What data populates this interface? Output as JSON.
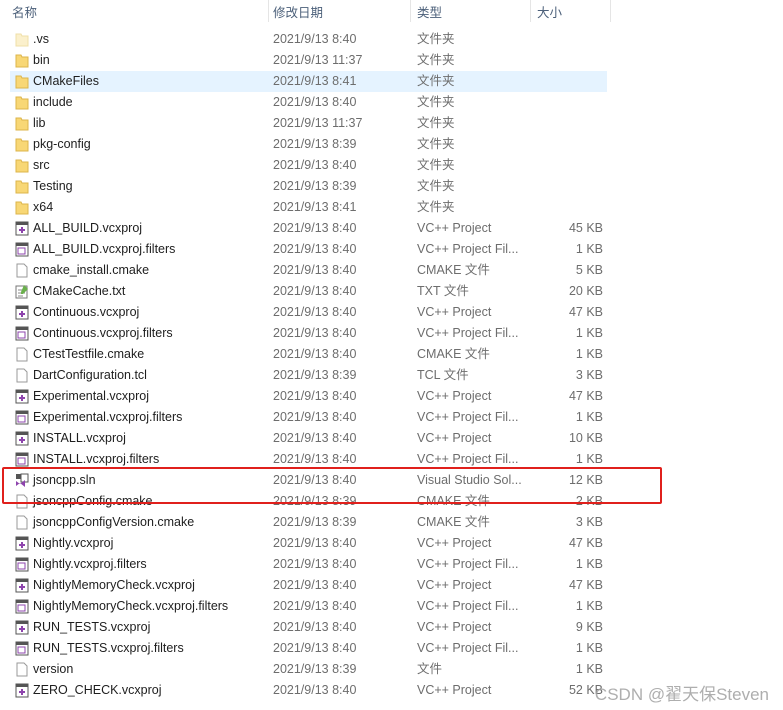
{
  "header": {
    "name": "名称",
    "date": "修改日期",
    "type": "类型",
    "size": "大小"
  },
  "files": [
    {
      "name": ".vs",
      "date": "2021/9/13 8:40",
      "type": "文件夹",
      "size": "",
      "icon": "folder-faded-icon"
    },
    {
      "name": "bin",
      "date": "2021/9/13 11:37",
      "type": "文件夹",
      "size": "",
      "icon": "folder-icon"
    },
    {
      "name": "CMakeFiles",
      "date": "2021/9/13 8:41",
      "type": "文件夹",
      "size": "",
      "icon": "folder-icon",
      "selected": true
    },
    {
      "name": "include",
      "date": "2021/9/13 8:40",
      "type": "文件夹",
      "size": "",
      "icon": "folder-icon"
    },
    {
      "name": "lib",
      "date": "2021/9/13 11:37",
      "type": "文件夹",
      "size": "",
      "icon": "folder-icon"
    },
    {
      "name": "pkg-config",
      "date": "2021/9/13 8:39",
      "type": "文件夹",
      "size": "",
      "icon": "folder-icon"
    },
    {
      "name": "src",
      "date": "2021/9/13 8:40",
      "type": "文件夹",
      "size": "",
      "icon": "folder-icon"
    },
    {
      "name": "Testing",
      "date": "2021/9/13 8:39",
      "type": "文件夹",
      "size": "",
      "icon": "folder-icon"
    },
    {
      "name": "x64",
      "date": "2021/9/13 8:41",
      "type": "文件夹",
      "size": "",
      "icon": "folder-icon"
    },
    {
      "name": "ALL_BUILD.vcxproj",
      "date": "2021/9/13 8:40",
      "type": "VC++ Project",
      "size": "45 KB",
      "icon": "vcxproj-icon"
    },
    {
      "name": "ALL_BUILD.vcxproj.filters",
      "date": "2021/9/13 8:40",
      "type": "VC++ Project Fil...",
      "size": "1 KB",
      "icon": "filters-icon"
    },
    {
      "name": "cmake_install.cmake",
      "date": "2021/9/13 8:40",
      "type": "CMAKE 文件",
      "size": "5 KB",
      "icon": "file-icon"
    },
    {
      "name": "CMakeCache.txt",
      "date": "2021/9/13 8:40",
      "type": "TXT 文件",
      "size": "20 KB",
      "icon": "text-file-icon"
    },
    {
      "name": "Continuous.vcxproj",
      "date": "2021/9/13 8:40",
      "type": "VC++ Project",
      "size": "47 KB",
      "icon": "vcxproj-icon"
    },
    {
      "name": "Continuous.vcxproj.filters",
      "date": "2021/9/13 8:40",
      "type": "VC++ Project Fil...",
      "size": "1 KB",
      "icon": "filters-icon"
    },
    {
      "name": "CTestTestfile.cmake",
      "date": "2021/9/13 8:40",
      "type": "CMAKE 文件",
      "size": "1 KB",
      "icon": "file-icon"
    },
    {
      "name": "DartConfiguration.tcl",
      "date": "2021/9/13 8:39",
      "type": "TCL 文件",
      "size": "3 KB",
      "icon": "file-icon"
    },
    {
      "name": "Experimental.vcxproj",
      "date": "2021/9/13 8:40",
      "type": "VC++ Project",
      "size": "47 KB",
      "icon": "vcxproj-icon"
    },
    {
      "name": "Experimental.vcxproj.filters",
      "date": "2021/9/13 8:40",
      "type": "VC++ Project Fil...",
      "size": "1 KB",
      "icon": "filters-icon"
    },
    {
      "name": "INSTALL.vcxproj",
      "date": "2021/9/13 8:40",
      "type": "VC++ Project",
      "size": "10 KB",
      "icon": "vcxproj-icon"
    },
    {
      "name": "INSTALL.vcxproj.filters",
      "date": "2021/9/13 8:40",
      "type": "VC++ Project Fil...",
      "size": "1 KB",
      "icon": "filters-icon"
    },
    {
      "name": "jsoncpp.sln",
      "date": "2021/9/13 8:40",
      "type": "Visual Studio Sol...",
      "size": "12 KB",
      "icon": "sln-icon"
    },
    {
      "name": "jsoncppConfig.cmake",
      "date": "2021/9/13 8:39",
      "type": "CMAKE 文件",
      "size": "2 KB",
      "icon": "file-icon"
    },
    {
      "name": "jsoncppConfigVersion.cmake",
      "date": "2021/9/13 8:39",
      "type": "CMAKE 文件",
      "size": "3 KB",
      "icon": "file-icon"
    },
    {
      "name": "Nightly.vcxproj",
      "date": "2021/9/13 8:40",
      "type": "VC++ Project",
      "size": "47 KB",
      "icon": "vcxproj-icon"
    },
    {
      "name": "Nightly.vcxproj.filters",
      "date": "2021/9/13 8:40",
      "type": "VC++ Project Fil...",
      "size": "1 KB",
      "icon": "filters-icon"
    },
    {
      "name": "NightlyMemoryCheck.vcxproj",
      "date": "2021/9/13 8:40",
      "type": "VC++ Project",
      "size": "47 KB",
      "icon": "vcxproj-icon"
    },
    {
      "name": "NightlyMemoryCheck.vcxproj.filters",
      "date": "2021/9/13 8:40",
      "type": "VC++ Project Fil...",
      "size": "1 KB",
      "icon": "filters-icon"
    },
    {
      "name": "RUN_TESTS.vcxproj",
      "date": "2021/9/13 8:40",
      "type": "VC++ Project",
      "size": "9 KB",
      "icon": "vcxproj-icon"
    },
    {
      "name": "RUN_TESTS.vcxproj.filters",
      "date": "2021/9/13 8:40",
      "type": "VC++ Project Fil...",
      "size": "1 KB",
      "icon": "filters-icon"
    },
    {
      "name": "version",
      "date": "2021/9/13 8:39",
      "type": "文件",
      "size": "1 KB",
      "icon": "file-icon"
    },
    {
      "name": "ZERO_CHECK.vcxproj",
      "date": "2021/9/13 8:40",
      "type": "VC++ Project",
      "size": "52 KB",
      "icon": "vcxproj-icon"
    }
  ],
  "watermark": "CSDN @翟天保Steven"
}
